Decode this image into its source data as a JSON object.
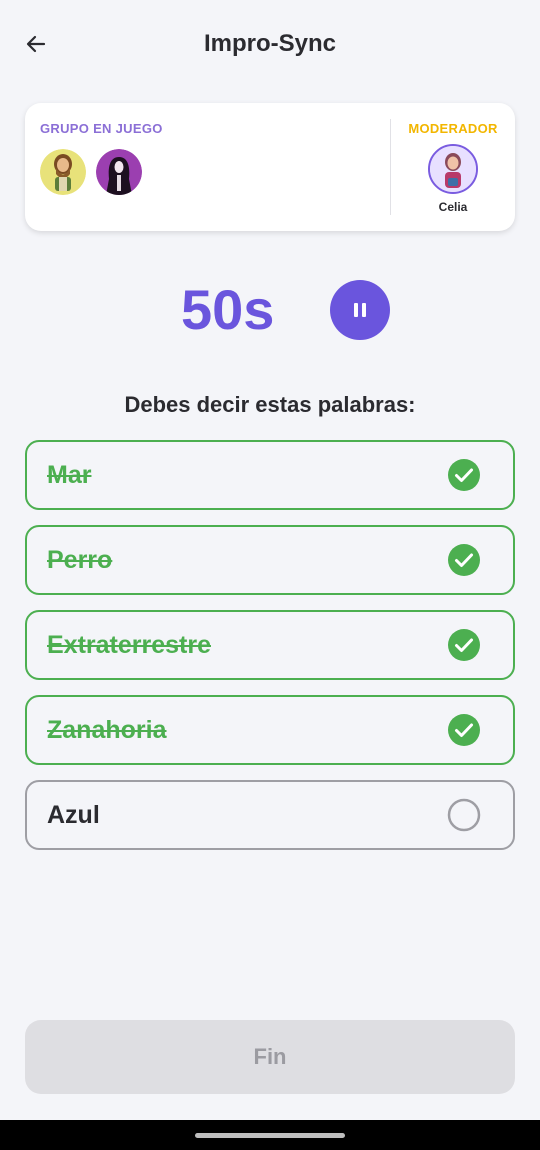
{
  "header": {
    "title": "Impro-Sync",
    "back_icon": "arrow-left-icon"
  },
  "group_card": {
    "group_label": "GRUPO EN JUEGO",
    "members": [
      {
        "avatar": "bearded-man-avatar"
      },
      {
        "avatar": "hooded-figure-avatar"
      }
    ],
    "moderator_label": "MODERADOR",
    "moderator_name": "Celia",
    "colors": {
      "group_label": "#8b6fd6",
      "moderator_label": "#f2b600"
    }
  },
  "timer": {
    "value": "50s",
    "pause_icon": "pause-icon",
    "accent": "#6a55dd"
  },
  "instruction": "Debes decir estas palabras:",
  "words": [
    {
      "text": "Mar",
      "done": true
    },
    {
      "text": "Perro",
      "done": true
    },
    {
      "text": "Extraterrestre",
      "done": true
    },
    {
      "text": "Zanahoria",
      "done": true
    },
    {
      "text": "Azul",
      "done": false
    }
  ],
  "status_colors": {
    "done": "#4caf50",
    "pending": "#9e9ea4"
  },
  "footer": {
    "finish_label": "Fin"
  }
}
